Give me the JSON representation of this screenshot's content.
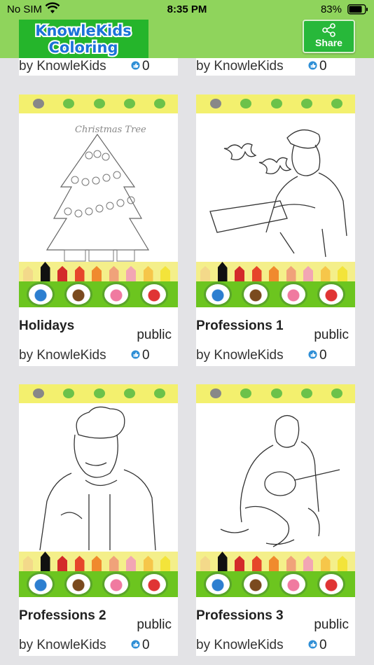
{
  "status": {
    "carrier": "No SIM",
    "time": "8:35 PM",
    "battery": "83%"
  },
  "header": {
    "logo_line1": "KnowleKids",
    "logo_line2": "Coloring",
    "share_label": "Share"
  },
  "colors": {
    "header_bg": "#8fd45c",
    "logo_bg": "#25b52b",
    "share_bg": "#27b83a",
    "page_bg": "#e3e3e6",
    "like_icon": "#2f8fd6"
  },
  "top_row": [
    {
      "author": "by KnowleKids",
      "likes": "0"
    },
    {
      "author": "by KnowleKids",
      "likes": "0"
    }
  ],
  "cards": [
    {
      "title": "Holidays",
      "visibility": "public",
      "author": "by KnowleKids",
      "likes": "0",
      "drawing": "christmas-tree",
      "drawing_text": "Christmas Tree"
    },
    {
      "title": "Professions 1",
      "visibility": "public",
      "author": "by KnowleKids",
      "likes": "0",
      "drawing": "baker"
    },
    {
      "title": "Professions 2",
      "visibility": "public",
      "author": "by KnowleKids",
      "likes": "0",
      "drawing": "chef"
    },
    {
      "title": "Professions 3",
      "visibility": "public",
      "author": "by KnowleKids",
      "likes": "0",
      "drawing": "guitarist"
    }
  ]
}
